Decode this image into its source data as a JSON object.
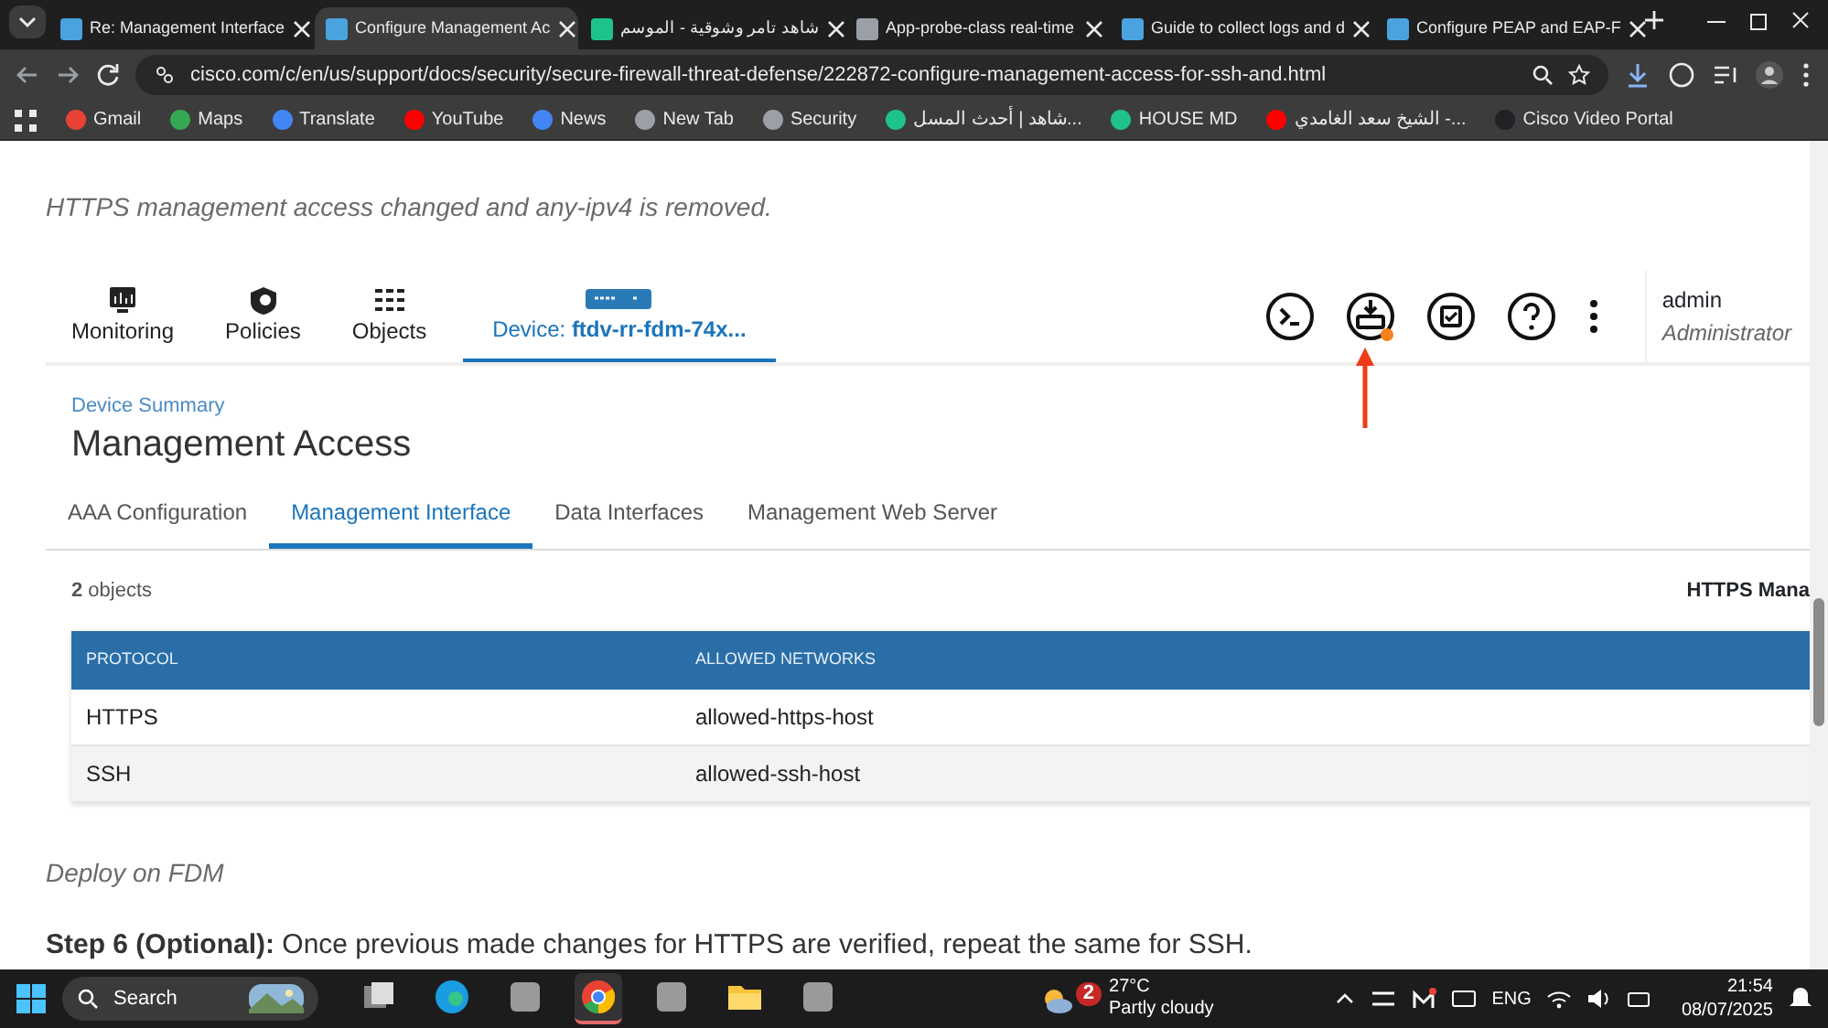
{
  "browser": {
    "tabs": [
      {
        "title": "Re: Management Interface",
        "selected": false,
        "color": "#4aa3df"
      },
      {
        "title": "Configure Management Ac",
        "selected": true,
        "color": "#4aa3df"
      },
      {
        "title": "شاهد تامر وشوقية - الموسم",
        "selected": false,
        "color": "#1ec28b"
      },
      {
        "title": "App-probe-class real-time",
        "selected": false,
        "color": "#9aa0a6"
      },
      {
        "title": "Guide to collect logs and d",
        "selected": false,
        "color": "#4aa3df"
      },
      {
        "title": "Configure PEAP and EAP-F",
        "selected": false,
        "color": "#4aa3df"
      }
    ],
    "url": "cisco.com/c/en/us/support/docs/security/secure-firewall-threat-defense/222872-configure-management-access-for-ssh-and.html",
    "bookmarks": [
      {
        "label": "Gmail",
        "color": "#ea4335"
      },
      {
        "label": "Maps",
        "color": "#34a853"
      },
      {
        "label": "Translate",
        "color": "#4285f4"
      },
      {
        "label": "YouTube",
        "color": "#ff0000"
      },
      {
        "label": "News",
        "color": "#4285f4"
      },
      {
        "label": "New Tab",
        "color": "#9aa0a6"
      },
      {
        "label": "Security",
        "color": "#9aa0a6"
      },
      {
        "label": "شاهد | أحدث المسل...",
        "color": "#1ec28b"
      },
      {
        "label": "HOUSE MD",
        "color": "#1ec28b"
      },
      {
        "label": "الشيخ سعد الغامدي -...",
        "color": "#ff0000"
      },
      {
        "label": "Cisco Video Portal",
        "color": "#202124"
      }
    ]
  },
  "page": {
    "caption_top": "HTTPS management access changed and any-ipv4 is removed.",
    "fdm": {
      "nav": [
        {
          "kind": "monitoring",
          "label": "Monitoring",
          "selected": false
        },
        {
          "kind": "policies",
          "label": "Policies",
          "selected": false
        },
        {
          "kind": "objects",
          "label": "Objects",
          "selected": false
        },
        {
          "kind": "device",
          "label": "Device: **ftdv-rr-fdm-74x...**",
          "selected": true
        }
      ],
      "user": {
        "name": "admin",
        "role": "Administrator"
      },
      "breadcrumb": "Device Summary",
      "heading": "Management Access",
      "subtabs": [
        {
          "label": "AAA Configuration",
          "selected": false
        },
        {
          "label": "Management Interface",
          "selected": true
        },
        {
          "label": "Data Interfaces",
          "selected": false
        },
        {
          "label": "Management Web Server",
          "selected": false
        }
      ],
      "count": "**2** objects",
      "section_label": "HTTPS Mana",
      "table": {
        "columns": [
          "PROTOCOL",
          "ALLOWED NETWORKS"
        ],
        "rows": [
          [
            "HTTPS",
            "allowed-https-host"
          ],
          [
            "SSH",
            "allowed-ssh-host"
          ]
        ]
      }
    },
    "caption_bottom": "Deploy on FDM",
    "step": "**Step 6 (Optional):** Once previous made changes for HTTPS are verified, repeat the same for SSH."
  },
  "taskbar": {
    "search": "Search",
    "weather": {
      "badge": "2",
      "temp": "27°C",
      "desc": "Partly cloudy"
    },
    "lang": "ENG",
    "time": "21:54",
    "date": "08/07/2025",
    "apps": [
      {
        "kind": "taskview",
        "active": false
      },
      {
        "kind": "edge",
        "active": false
      },
      {
        "kind": "blank",
        "active": false
      },
      {
        "kind": "chrome",
        "active": true
      },
      {
        "kind": "blank",
        "active": false
      },
      {
        "kind": "files",
        "active": false
      },
      {
        "kind": "blank",
        "active": false
      }
    ]
  }
}
